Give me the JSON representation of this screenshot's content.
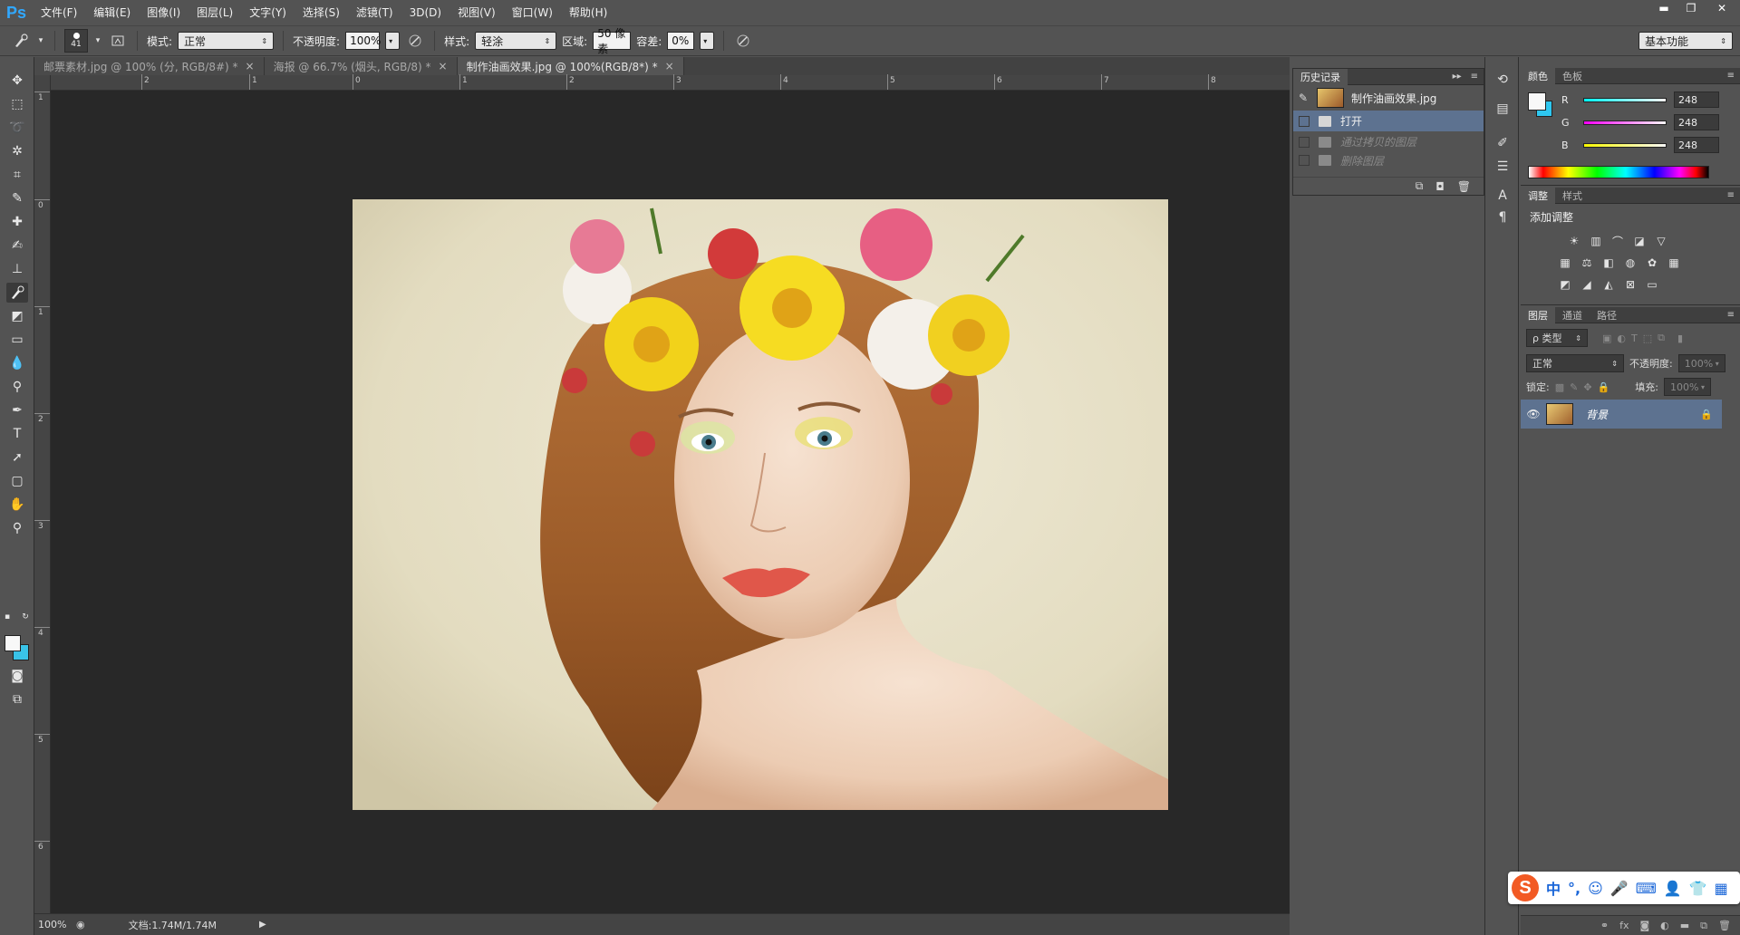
{
  "app": {
    "logo": "Ps"
  },
  "menu": [
    "文件(F)",
    "编辑(E)",
    "图像(I)",
    "图层(L)",
    "文字(Y)",
    "选择(S)",
    "滤镜(T)",
    "3D(D)",
    "视图(V)",
    "窗口(W)",
    "帮助(H)"
  ],
  "window_controls": {
    "min": "▬",
    "max": "❐",
    "close": "✕"
  },
  "options": {
    "brush_size": "41",
    "mode_label": "模式:",
    "mode_value": "正常",
    "opacity_label": "不透明度:",
    "opacity_value": "100%",
    "style_label": "样式:",
    "style_value": "轻涂",
    "area_label": "区域:",
    "area_value": "50 像素",
    "tolerance_label": "容差:",
    "tolerance_value": "0%",
    "workspace": "基本功能"
  },
  "tabs": [
    {
      "label": "邮票素材.jpg @ 100% (分, RGB/8#) *",
      "close": "×"
    },
    {
      "label": "海报 @ 66.7% (烟头, RGB/8) *",
      "close": "×"
    },
    {
      "label": "制作油画效果.jpg @ 100%(RGB/8*) *",
      "close": "×"
    }
  ],
  "ruler_h": [
    "2",
    "1",
    "0",
    "1",
    "2",
    "3",
    "4",
    "5",
    "6",
    "7",
    "8"
  ],
  "ruler_v": [
    "1",
    "0",
    "1",
    "2",
    "3",
    "4",
    "5",
    "6"
  ],
  "status": {
    "zoom": "100%",
    "doc": "文档:1.74M/1.74M",
    "arrow": "▶"
  },
  "history": {
    "tab": "历史记录",
    "snapshot": "制作油画效果.jpg",
    "items": [
      {
        "label": "打开",
        "state": "active"
      },
      {
        "label": "通过拷贝的图层",
        "state": "dim"
      },
      {
        "label": "删除图层",
        "state": "dim"
      }
    ],
    "collapse": "▸▸",
    "menu": "≡"
  },
  "color": {
    "tabs": [
      "颜色",
      "色板"
    ],
    "r_label": "R",
    "r_value": "248",
    "g_label": "G",
    "g_value": "248",
    "b_label": "B",
    "b_value": "248",
    "fg": "#f8f8f8",
    "bg": "#2ec7f0",
    "menu": "≡"
  },
  "adjustments": {
    "tabs": [
      "调整",
      "样式"
    ],
    "title": "添加调整",
    "menu": "≡"
  },
  "layers": {
    "tabs": [
      "图层",
      "通道",
      "路径"
    ],
    "kind": "ρ 类型",
    "blend": "正常",
    "opacity_label": "不透明度:",
    "opacity_value": "100%",
    "lock_label": "锁定:",
    "fill_label": "填充:",
    "fill_value": "100%",
    "layer_name": "背景",
    "menu": "≡"
  },
  "ime": {
    "mode": "中",
    "punct": "°,"
  }
}
